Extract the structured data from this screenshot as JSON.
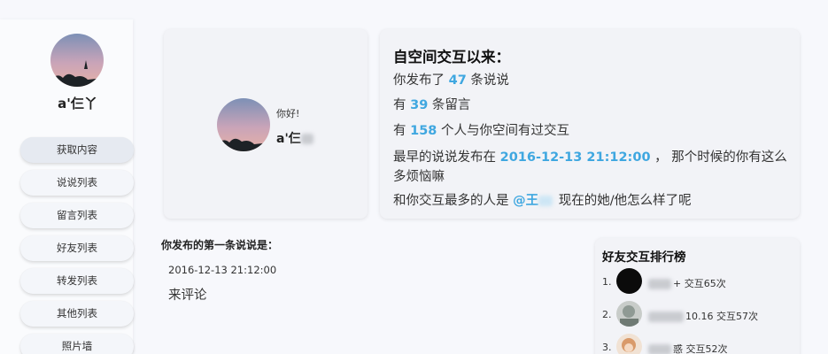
{
  "sidebar": {
    "nickname": "a'仨丫",
    "nav": [
      "获取内容",
      "说说列表",
      "留言列表",
      "好友列表",
      "转发列表",
      "其他列表",
      "照片墙"
    ]
  },
  "profile": {
    "greeting": "你好!",
    "nickname": "a'仨"
  },
  "stats": {
    "title": "自空间交互以来：",
    "line1": {
      "pre": "你发布了 ",
      "num": "47",
      "post": " 条说说"
    },
    "line2": {
      "pre": "有 ",
      "num": "39",
      "post": " 条留言"
    },
    "line3": {
      "pre": "有 ",
      "num": "158",
      "post": " 个人与你空间有过交互"
    },
    "line4": {
      "pre": "最早的说说发布在 ",
      "num": "2016-12-13 21:12:00",
      "post": " ， 那个时候的你有这么",
      "post2": "多烦恼嘛"
    },
    "line5": {
      "pre": "和你交互最多的人是 ",
      "num": "@王",
      "post": " 现在的她/他怎么样了呢"
    }
  },
  "first_post": {
    "title": "你发布的第一条说说是：",
    "date": "2016-12-13 21:12:00",
    "text": "来评论"
  },
  "ranking": {
    "title": "好友交互排行榜",
    "items": [
      {
        "index": "1.",
        "name_tail": "+ 交互65次"
      },
      {
        "index": "2.",
        "name_tail": "10.16 交互57次"
      },
      {
        "index": "3.",
        "name_tail": "惑 交互52次"
      }
    ]
  },
  "colors": {
    "accent": "#3fa7e0",
    "background": "#f7f8fc",
    "card": "#f2f3f7"
  }
}
